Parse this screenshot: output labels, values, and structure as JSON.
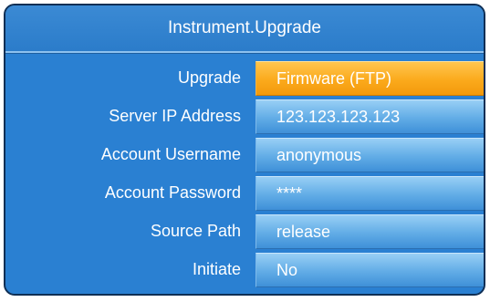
{
  "title": "Instrument.Upgrade",
  "rows": [
    {
      "label": "Upgrade",
      "value": "Firmware (FTP)",
      "selected": true
    },
    {
      "label": "Server IP Address",
      "value": "123.123.123.123"
    },
    {
      "label": "Account Username",
      "value": "anonymous"
    },
    {
      "label": "Account Password",
      "value": "****"
    },
    {
      "label": "Source Path",
      "value": "release"
    },
    {
      "label": "Initiate",
      "value": "No"
    }
  ]
}
